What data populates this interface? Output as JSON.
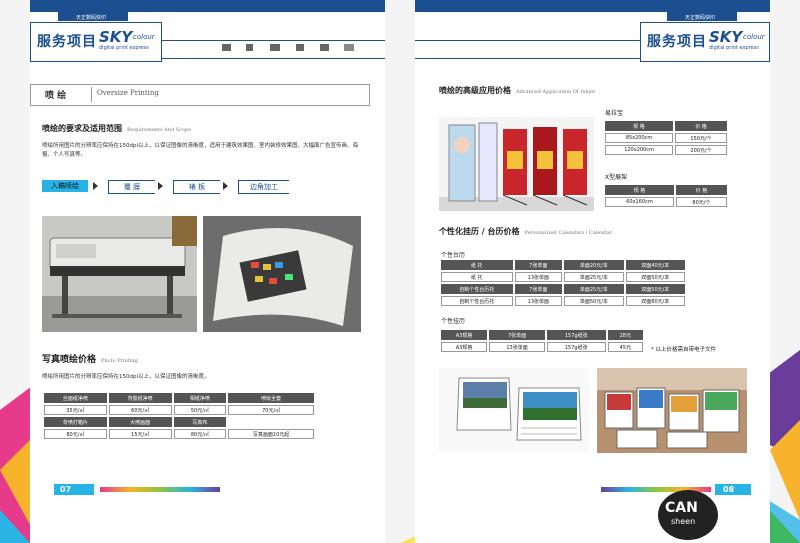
{
  "brand": {
    "tag": "天正数码快印",
    "title_cn": "服务项目",
    "sky": "SKY",
    "colour": "colour",
    "subtitle": "digital print express"
  },
  "left": {
    "section_cn": "喷 绘",
    "section_en": "Oversize Printing",
    "requirements_title": "喷绘的要求及适用范围",
    "requirements_en": "Requirements And Scope",
    "requirements_text": "喷绘所用图片的分辨率应保持在150dpi以上，以保证图像的清晰度，适用于建筑效果图、室内装修效果图、大幅面广告宣传画、海报、个人写真等。",
    "steps": [
      "入稿喷绘",
      "覆 膜",
      "裱 板",
      "边角加工"
    ],
    "photo_title": "写真喷绘价格",
    "photo_title_en": "Photo Printing",
    "photo_text": "喷绘所用图片的分辨率应保持在150dpi以上，以保证图像的清晰度。",
    "price_table": [
      [
        "丝面纸净喷",
        "背胶纸净喷",
        "相纸净喷",
        "喷绘全套"
      ],
      [
        "35元/㎡",
        "60元/㎡",
        "50元/㎡",
        "70元/㎡"
      ],
      [
        "背喷灯箱片",
        "大喷画面",
        "写真布",
        ""
      ],
      [
        "80元/㎡",
        "15元/㎡",
        "80元/㎡",
        "写真画面10元起"
      ]
    ],
    "page_number": "07"
  },
  "right": {
    "advanced_title": "喷绘的高级应用价格",
    "advanced_en": "Advanced Application Of Inkjet",
    "yilabao_label": "易拉宝",
    "yilabao_table": [
      [
        "规 格",
        "价 格"
      ],
      [
        "85x200cm",
        "150元/个"
      ],
      [
        "120x200cm",
        "200元/个"
      ]
    ],
    "xframe_label": "X型展架",
    "xframe_table": [
      [
        "规 格",
        "价 格"
      ],
      [
        "60x160cm",
        "80元/个"
      ]
    ],
    "calendar_title": "个性化挂历 / 台历价格",
    "calendar_en": "Personalized Calendars / Calendar",
    "desk_label": "个性台历",
    "desk_table": [
      [
        "纸 托",
        "7张单面",
        "单面20元/本",
        "双面40元/本"
      ],
      [
        "纸 托",
        "13张单面",
        "单面25元/本",
        "双面50元/本"
      ],
      [
        "自制个性台历托",
        "7张单面",
        "单面25元/本",
        "双面50元/本"
      ],
      [
        "自制个性台历托",
        "13张单面",
        "单面50元/本",
        "双面80元/本"
      ]
    ],
    "wall_label": "个性挂历",
    "wall_table": [
      [
        "A3规格",
        "7张单面",
        "157g纸张",
        "28元"
      ],
      [
        "A3规格",
        "13张单面",
        "157g纸张",
        "45元"
      ]
    ],
    "wall_note": "* 以上价格需自带电子文件",
    "page_number": "08",
    "logo_can": "CAN",
    "logo_sheen": "sheen"
  },
  "colors": {
    "brand": "#1b4f8f",
    "accent": "#27b3e6",
    "table_head": "#555555"
  }
}
